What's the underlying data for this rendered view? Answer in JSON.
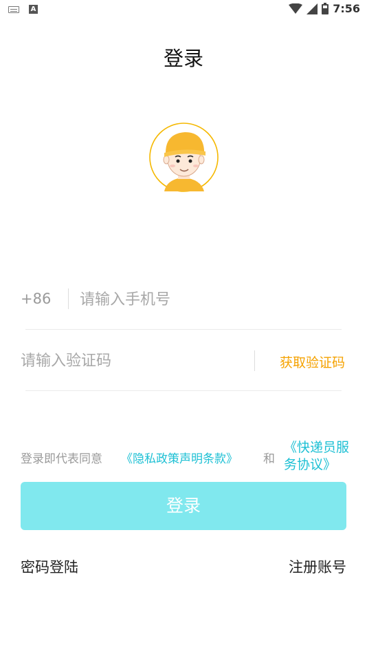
{
  "status_bar": {
    "time": "7:56",
    "left_icons": [
      "keyboard-icon",
      "a-icon"
    ],
    "a_label": "A"
  },
  "header": {
    "title": "登录"
  },
  "phone": {
    "prefix": "+86",
    "placeholder": "请输入手机号"
  },
  "code": {
    "placeholder": "请输入验证码",
    "get_code_label": "获取验证码"
  },
  "agreement": {
    "prefix": "登录即代表同意",
    "privacy_link": "《隐私政策声明条款》",
    "and": "和",
    "courier_link": "《快递员服务协议》"
  },
  "login_button": {
    "label": "登录"
  },
  "bottom_links": {
    "password_login": "密码登陆",
    "register": "注册账号"
  },
  "colors": {
    "accent_cyan": "#1ec0d4",
    "button_bg": "#80e8ee",
    "orange": "#f5a200",
    "avatar_ring": "#f5b800"
  }
}
